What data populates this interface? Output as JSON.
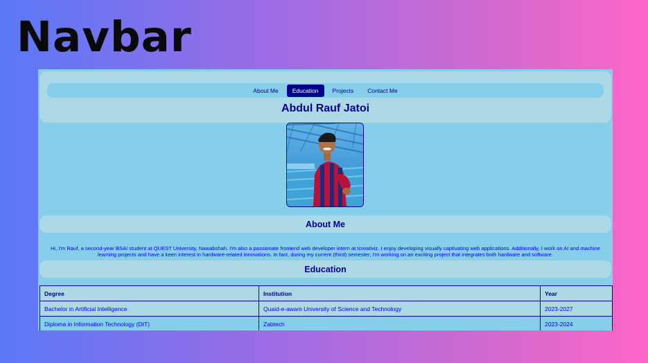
{
  "banner": {
    "title": "Navbar"
  },
  "header": {
    "nav": [
      {
        "label": "About Me",
        "active": false
      },
      {
        "label": "Education",
        "active": true
      },
      {
        "label": "Projects",
        "active": false
      },
      {
        "label": "Contact Me",
        "active": false
      }
    ],
    "site_title": "Abdul Rauf Jatoi"
  },
  "about": {
    "heading": "About Me",
    "text": "Hi, I'm Rauf, a second-year BSAI student at QUEST University, Nawabshah. I'm also a passionate frontend web developer intern at Icreativiz. I enjoy developing visually captivating web applications. Additionally, I work on AI and machine learning projects and have a keen interest in hardware-related innovations. In fact, during my current (third) semester, I'm working on an exciting project that integrates both hardware and software."
  },
  "education": {
    "heading": "Education",
    "columns": [
      "Degree",
      "Institution",
      "Year"
    ],
    "rows": [
      [
        "Bachelor in Artificial Intelligence",
        "Quaid-e-awam University of Science and Technology",
        "2023-2027"
      ],
      [
        "Diploma in Information Technology (DIT)",
        "Zabtech",
        "2023-2024"
      ]
    ]
  },
  "colors": {
    "accent": "#00008b",
    "page_bg": "#87ceeb",
    "panel_bg": "#add8e6",
    "link_text": "#0000ee"
  }
}
